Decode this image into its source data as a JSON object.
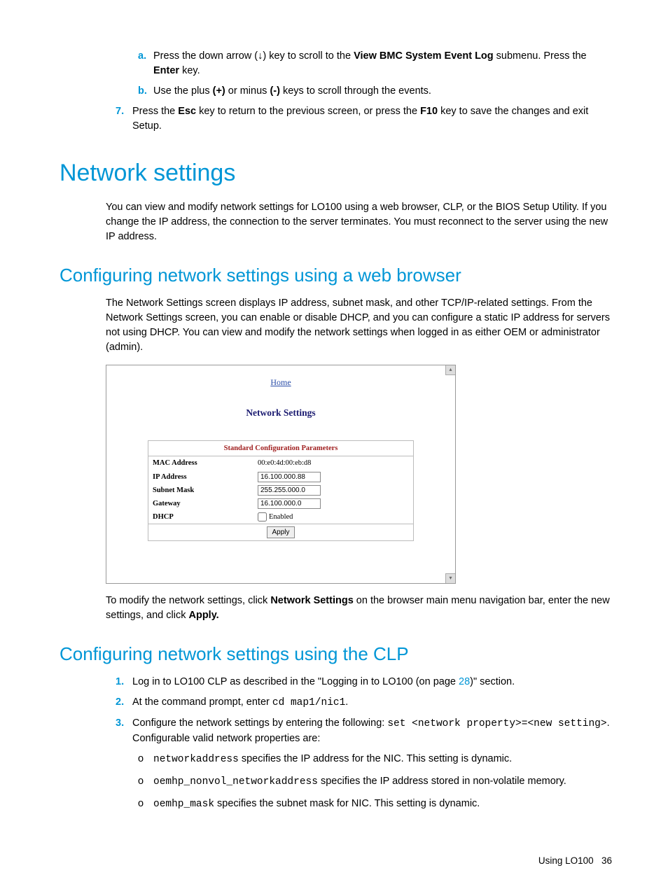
{
  "top_sub_list": {
    "a": {
      "marker": "a.",
      "pre": "Press the down arrow (↓) key to scroll to the ",
      "bold": "View BMC System Event Log",
      "post": " submenu. Press the ",
      "bold2": "Enter",
      "post2": " key."
    },
    "b": {
      "marker": "b.",
      "pre": "Use the plus ",
      "bold": "(+)",
      "mid": " or minus ",
      "bold2": "(-)",
      "post": " keys to scroll through the events."
    }
  },
  "top_main_list": {
    "n7": {
      "marker": "7.",
      "pre": "Press the ",
      "bold": "Esc",
      "mid": " key to return to the previous screen, or press the ",
      "bold2": "F10",
      "post": " key to save the changes and exit Setup."
    }
  },
  "h1": "Network settings",
  "p1": "You can view and modify network settings for LO100 using a web browser, CLP, or the BIOS Setup Utility. If you change the IP address, the connection to the server terminates. You must reconnect to the server using the new IP address.",
  "h2a": "Configuring network settings using a web browser",
  "p2": "The Network Settings screen displays IP address, subnet mask, and other TCP/IP-related settings. From the Network Settings screen, you can enable or disable DHCP, and you can configure a static IP address for servers not using DHCP. You can view and modify the network settings when logged in as either OEM or administrator (admin).",
  "figure": {
    "home": "Home",
    "title": "Network Settings",
    "thead": "Standard Configuration Parameters",
    "rows": {
      "mac": {
        "label": "MAC Address",
        "value": "00:e0:4d:00:eb:d8"
      },
      "ip": {
        "label": "IP Address",
        "value": "16.100.000.88"
      },
      "subnet": {
        "label": "Subnet Mask",
        "value": "255.255.000.0"
      },
      "gw": {
        "label": "Gateway",
        "value": "16.100.000.0"
      },
      "dhcp": {
        "label": "DHCP",
        "value": "Enabled"
      }
    },
    "apply": "Apply"
  },
  "p3": {
    "pre": "To modify the network settings, click ",
    "bold": "Network Settings",
    "mid": " on the browser main menu navigation bar, enter the new settings, and click ",
    "bold2": "Apply."
  },
  "h2b": "Configuring network settings using the CLP",
  "clp_list": {
    "n1": {
      "marker": "1.",
      "pre": "Log in to LO100 CLP as described in the \"Logging in to LO100 (on page ",
      "link": "28",
      "post": ")\" section."
    },
    "n2": {
      "marker": "2.",
      "pre": "At the command prompt, enter ",
      "code": "cd map1/nic1",
      "post": "."
    },
    "n3": {
      "marker": "3.",
      "pre": "Configure the network settings by entering the following: ",
      "code": "set <network property>=<new setting>",
      "post": ". Configurable valid network properties are:"
    }
  },
  "bullets": {
    "b1": {
      "code": "networkaddress",
      "text": " specifies the IP address for the NIC. This setting is dynamic."
    },
    "b2": {
      "code": "oemhp_nonvol_networkaddress",
      "text": " specifies the IP address stored in non-volatile memory."
    },
    "b3": {
      "code": "oemhp_mask",
      "text": " specifies the subnet mask for NIC. This setting is dynamic."
    }
  },
  "footer": {
    "text": "Using LO100",
    "page": "36"
  }
}
